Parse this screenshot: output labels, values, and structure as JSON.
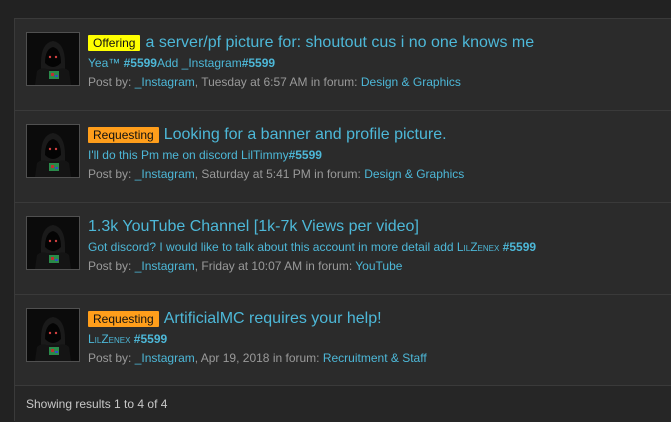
{
  "results": [
    {
      "tag": "Offering",
      "tag_color": "#ffff00",
      "title": "a server/pf picture for: shoutout cus i no one knows me",
      "snippet": [
        {
          "text": "Yea™ ",
          "bold": false
        },
        {
          "text": "#5599",
          "bold": true
        },
        {
          "text": "Add _Instagram",
          "bold": false
        },
        {
          "text": "#5599",
          "bold": true
        }
      ],
      "meta": {
        "prefix": "Post by:",
        "author": "_Instagram",
        "time": "Tuesday at 6:57 AM",
        "forum_prefix": "in forum:",
        "forum": "Design & Graphics"
      }
    },
    {
      "tag": "Requesting",
      "tag_color": "#ff9e1b",
      "title": "Looking for a banner and profile picture.",
      "snippet": [
        {
          "text": "I'll do this Pm me on discord LilTimmy",
          "bold": false
        },
        {
          "text": "#5599",
          "bold": true
        }
      ],
      "meta": {
        "prefix": "Post by:",
        "author": "_Instagram",
        "time": "Saturday at 5:41 PM",
        "forum_prefix": "in forum:",
        "forum": "Design & Graphics"
      }
    },
    {
      "tag": "",
      "tag_color": "",
      "title": "1.3k YouTube Channel [1k-7k Views per video]",
      "snippet": [
        {
          "text": "Got discord? I would like to talk about this account in more detail add ",
          "bold": false
        },
        {
          "text": "LilZenex",
          "bold": false,
          "smallcaps": true
        },
        {
          "text": " #5599",
          "bold": true
        }
      ],
      "meta": {
        "prefix": "Post by:",
        "author": "_Instagram",
        "time": "Friday at 10:07 AM",
        "forum_prefix": "in forum:",
        "forum": "YouTube"
      }
    },
    {
      "tag": "Requesting",
      "tag_color": "#ff9e1b",
      "title": "ArtificialMC requires your help!",
      "snippet": [
        {
          "text": "LilZenex",
          "bold": false,
          "smallcaps": true
        },
        {
          "text": " #5599",
          "bold": true
        }
      ],
      "meta": {
        "prefix": "Post by:",
        "author": "_Instagram",
        "time": "Apr 19, 2018",
        "forum_prefix": "in forum:",
        "forum": "Recruitment & Staff"
      }
    }
  ],
  "footer": {
    "text": "Showing results 1 to 4 of 4"
  }
}
